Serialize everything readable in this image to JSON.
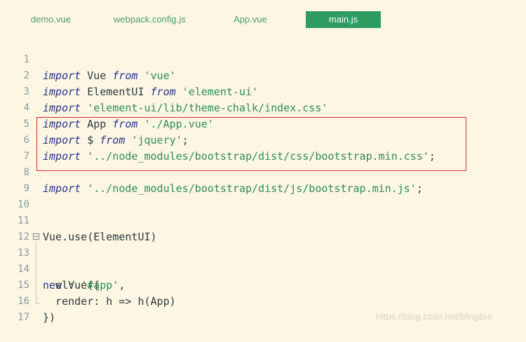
{
  "tabs": [
    {
      "label": "demo.vue",
      "active": false
    },
    {
      "label": "webpack.config.js",
      "active": false
    },
    {
      "label": "App.vue",
      "active": false
    },
    {
      "label": "main.js",
      "active": true
    }
  ],
  "editor": {
    "line_numbers": [
      "1",
      "2",
      "3",
      "4",
      "5",
      "6",
      "7",
      "8",
      "9",
      "10",
      "11",
      "12",
      "13",
      "14",
      "15",
      "16",
      "17"
    ],
    "line1": {
      "kw": "import",
      "id": " Vue ",
      "kw2": "from",
      "str": " 'vue'"
    },
    "line2": {
      "kw": "import",
      "id": " ElementUI ",
      "kw2": "from",
      "str": " 'element-ui'"
    },
    "line3": {
      "kw": "import",
      "str": " 'element-ui/lib/theme-chalk/index.css'"
    },
    "line4": {
      "kw": "import",
      "id": " App ",
      "kw2": "from",
      "str": " './App.vue'"
    },
    "line5": {
      "kw": "import",
      "id": " $ ",
      "kw2": "from",
      "str": " 'jquery'",
      "pun": ";"
    },
    "line6": {
      "kw": "import",
      "str": " '../node_modules/bootstrap/dist/css/bootstrap.min.css'",
      "pun": ";"
    },
    "line8": {
      "kw": "import",
      "str": " '../node_modules/bootstrap/dist/js/bootstrap.min.js'",
      "pun": ";"
    },
    "line11": {
      "id": "Vue.use(ElementUI)"
    },
    "line13": {
      "kw": "new",
      "id": " Vue({"
    },
    "line14": {
      "id": "  el: ",
      "str": "'#app'",
      "pun": ","
    },
    "line15": {
      "id": "  render: h => h(App)"
    },
    "line16": {
      "id": "})"
    }
  },
  "watermark": "https://blog.csdn.net/blingbro",
  "colors": {
    "background": "#fdf6e3",
    "keyword": "#25338e",
    "string": "#2e8d57",
    "active_tab": "#2e9b61",
    "highlight_border": "#d9262b"
  }
}
